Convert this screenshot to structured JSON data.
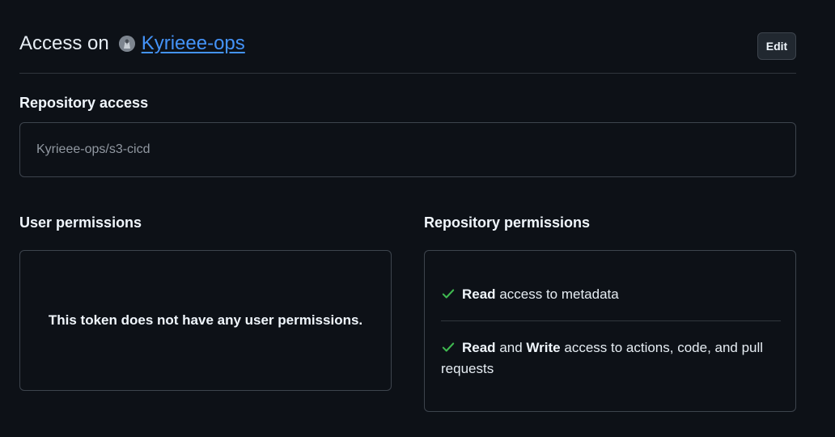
{
  "header": {
    "title_prefix": "Access on",
    "owner_name": "Kyrieee-ops",
    "edit_label": "Edit"
  },
  "repository_access": {
    "heading": "Repository access",
    "repo_name": "Kyrieee-ops/s3-cicd"
  },
  "user_permissions": {
    "heading": "User permissions",
    "message": "This token does not have any user permissions."
  },
  "repository_permissions": {
    "heading": "Repository permissions",
    "items": [
      {
        "icon": "check-icon",
        "level_1": "Read",
        "connector": "",
        "level_2": "",
        "description": "access to metadata"
      },
      {
        "icon": "check-icon",
        "level_1": "Read",
        "connector": "and",
        "level_2": "Write",
        "description": "access to actions, code, and pull requests"
      }
    ]
  },
  "colors": {
    "background": "#0d1117",
    "link": "#4493f8",
    "check": "#3fb950",
    "border": "#3d444d"
  }
}
